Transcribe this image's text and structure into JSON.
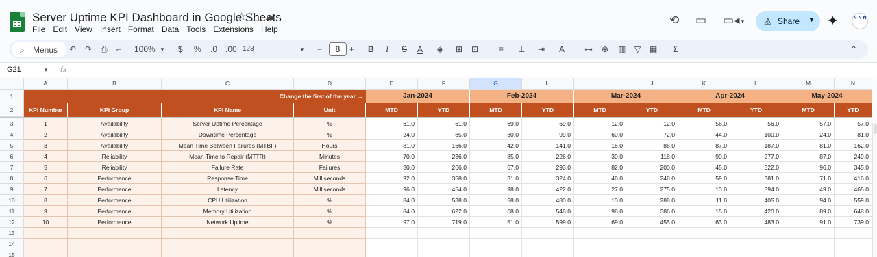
{
  "doc": {
    "title": "Server Uptime KPI Dashboard in Google Sheets",
    "menus": [
      "File",
      "Edit",
      "View",
      "Insert",
      "Format",
      "Data",
      "Tools",
      "Extensions",
      "Help"
    ],
    "share_label": "Share",
    "avatar_text": "N N N"
  },
  "toolbar": {
    "search_label": "Menus",
    "zoom": "100%",
    "currency": "$",
    "percent": "%",
    "dec_decrease": ".0",
    "dec_increase": ".00",
    "number_format": "123",
    "font_size": "8",
    "minus": "−",
    "plus": "+",
    "bold": "B",
    "italic": "I",
    "strike": "S",
    "text_color": "A",
    "fill_color_icon": "paint-bucket-icon"
  },
  "formula_bar": {
    "cell_ref": "G21",
    "fx": "fx",
    "content": ""
  },
  "colors": {
    "header_dark": "#c0501f",
    "header_light": "#f4b183",
    "row_fill": "#fdf2ea",
    "accent": "#0b57d0"
  },
  "sheet": {
    "column_letters": [
      "A",
      "B",
      "C",
      "D",
      "E",
      "F",
      "G",
      "H",
      "I",
      "J",
      "K",
      "L",
      "M",
      "N"
    ],
    "selected_column": "G",
    "row_numbers": [
      "1",
      "2",
      "3",
      "4",
      "5",
      "6",
      "7",
      "8",
      "9",
      "10",
      "11",
      "12",
      "13",
      "14",
      "15"
    ],
    "banner_text": "Change the first of the year →",
    "months": [
      "Jan-2024",
      "Feb-2024",
      "Mar-2024",
      "Apr-2024",
      "May-2024"
    ],
    "left_headers": [
      "KPI Number",
      "KPI Group",
      "KPI Name",
      "Unit"
    ],
    "mtd": "MTD",
    "ytd": "YTD",
    "rows": [
      {
        "num": "1",
        "group": "Availability",
        "name": "Server Uptime Percentage",
        "unit": "%",
        "values": [
          "61.0",
          "61.0",
          "69.0",
          "69.0",
          "12.0",
          "12.0",
          "56.0",
          "56.0",
          "57.0",
          "57.0"
        ]
      },
      {
        "num": "2",
        "group": "Availability",
        "name": "Downtime Percentage",
        "unit": "%",
        "values": [
          "24.0",
          "85.0",
          "30.0",
          "99.0",
          "60.0",
          "72.0",
          "44.0",
          "100.0",
          "24.0",
          "81.0"
        ]
      },
      {
        "num": "3",
        "group": "Availability",
        "name": "Mean Time Between Failures (MTBF)",
        "unit": "Hours",
        "values": [
          "81.0",
          "166.0",
          "42.0",
          "141.0",
          "16.0",
          "88.0",
          "87.0",
          "187.0",
          "81.0",
          "162.0"
        ]
      },
      {
        "num": "4",
        "group": "Reliability",
        "name": "Mean Time to Repair (MTTR)",
        "unit": "Minutes",
        "values": [
          "70.0",
          "236.0",
          "85.0",
          "226.0",
          "30.0",
          "118.0",
          "90.0",
          "277.0",
          "87.0",
          "249.0"
        ]
      },
      {
        "num": "5",
        "group": "Reliability",
        "name": "Failure Rate",
        "unit": "Failures",
        "values": [
          "30.0",
          "266.0",
          "67.0",
          "293.0",
          "82.0",
          "200.0",
          "45.0",
          "322.0",
          "96.0",
          "345.0"
        ]
      },
      {
        "num": "6",
        "group": "Performance",
        "name": "Response Time",
        "unit": "Milliseconds",
        "values": [
          "92.0",
          "358.0",
          "31.0",
          "324.0",
          "48.0",
          "248.0",
          "59.0",
          "381.0",
          "71.0",
          "416.0"
        ]
      },
      {
        "num": "7",
        "group": "Performance",
        "name": "Latency",
        "unit": "Milliseconds",
        "values": [
          "96.0",
          "454.0",
          "98.0",
          "422.0",
          "27.0",
          "275.0",
          "13.0",
          "394.0",
          "49.0",
          "465.0"
        ]
      },
      {
        "num": "8",
        "group": "Performance",
        "name": "CPU Utilization",
        "unit": "%",
        "values": [
          "84.0",
          "538.0",
          "58.0",
          "480.0",
          "13.0",
          "288.0",
          "11.0",
          "405.0",
          "94.0",
          "559.0"
        ]
      },
      {
        "num": "9",
        "group": "Performance",
        "name": "Memory Utilization",
        "unit": "%",
        "values": [
          "84.0",
          "622.0",
          "68.0",
          "548.0",
          "98.0",
          "386.0",
          "15.0",
          "420.0",
          "89.0",
          "648.0"
        ]
      },
      {
        "num": "10",
        "group": "Performance",
        "name": "Network Uptime",
        "unit": "%",
        "values": [
          "97.0",
          "719.0",
          "51.0",
          "599.0",
          "69.0",
          "455.0",
          "63.0",
          "483.0",
          "91.0",
          "739.0"
        ]
      }
    ]
  }
}
